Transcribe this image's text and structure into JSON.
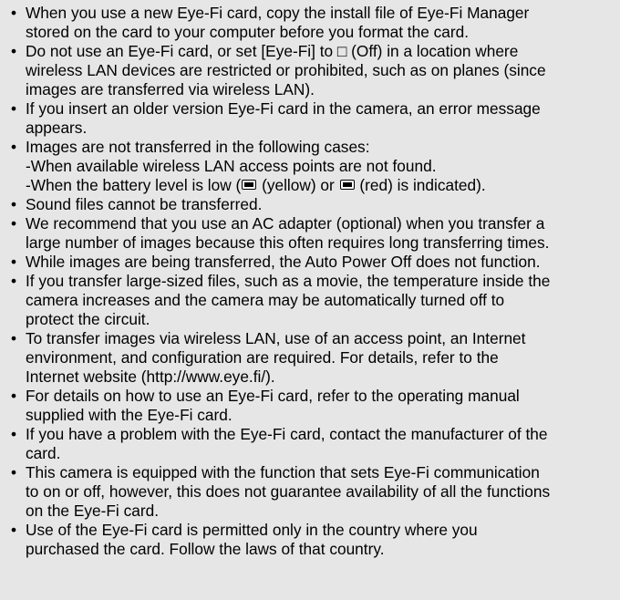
{
  "bullet_glyph": "•",
  "notes": [
    {
      "lines": [
        "When you use a new Eye-Fi card, copy the install file of Eye-Fi Manager",
        "stored on the card to your computer before you format the card."
      ]
    },
    {
      "lines": [
        "Do not use an Eye-Fi card, or set [Eye-Fi] to □ (Off) in a location where",
        "wireless LAN devices are restricted or prohibited, such as on planes (since",
        "images are transferred via wireless LAN)."
      ]
    },
    {
      "lines": [
        "If you insert an older version Eye-Fi card in the camera, an error message",
        "appears."
      ]
    },
    {
      "lines": [
        "Images are not transferred in the following cases:",
        "-When available wireless LAN access points are not found."
      ],
      "battery_line": {
        "before": "-When the battery level is low (",
        "middle": " (yellow) or ",
        "after": " (red) is indicated).",
        "icon_name": "battery-low-icon"
      }
    },
    {
      "lines": [
        "Sound files cannot be transferred."
      ]
    },
    {
      "lines": [
        "We recommend that you use an AC adapter (optional) when you transfer a",
        "large number of images because this often requires long transferring times."
      ]
    },
    {
      "lines": [
        "While images are being transferred, the Auto Power Off does not function."
      ]
    },
    {
      "lines": [
        "If you transfer large-sized files, such as a movie, the temperature inside the",
        "camera increases and the camera may be automatically turned off to",
        "protect the circuit."
      ]
    },
    {
      "lines": [
        "To transfer images via wireless LAN, use of an access point, an Internet",
        "environment, and configuration are required. For details, refer to the",
        "Internet website (http://www.eye.fi/)."
      ]
    },
    {
      "lines": [
        "For details on how to use an Eye-Fi card, refer to the operating manual",
        "supplied with the Eye-Fi card."
      ]
    },
    {
      "lines": [
        "If you have a problem with the Eye-Fi card, contact the manufacturer of the",
        "card."
      ]
    },
    {
      "lines": [
        "This camera is equipped with the function that sets Eye-Fi communication",
        "to on or off, however, this does not guarantee availability of all the functions",
        "on the Eye-Fi card."
      ]
    },
    {
      "lines": [
        "Use of the Eye-Fi card is permitted only in the country where you",
        "purchased the card. Follow the laws of that country."
      ]
    }
  ]
}
